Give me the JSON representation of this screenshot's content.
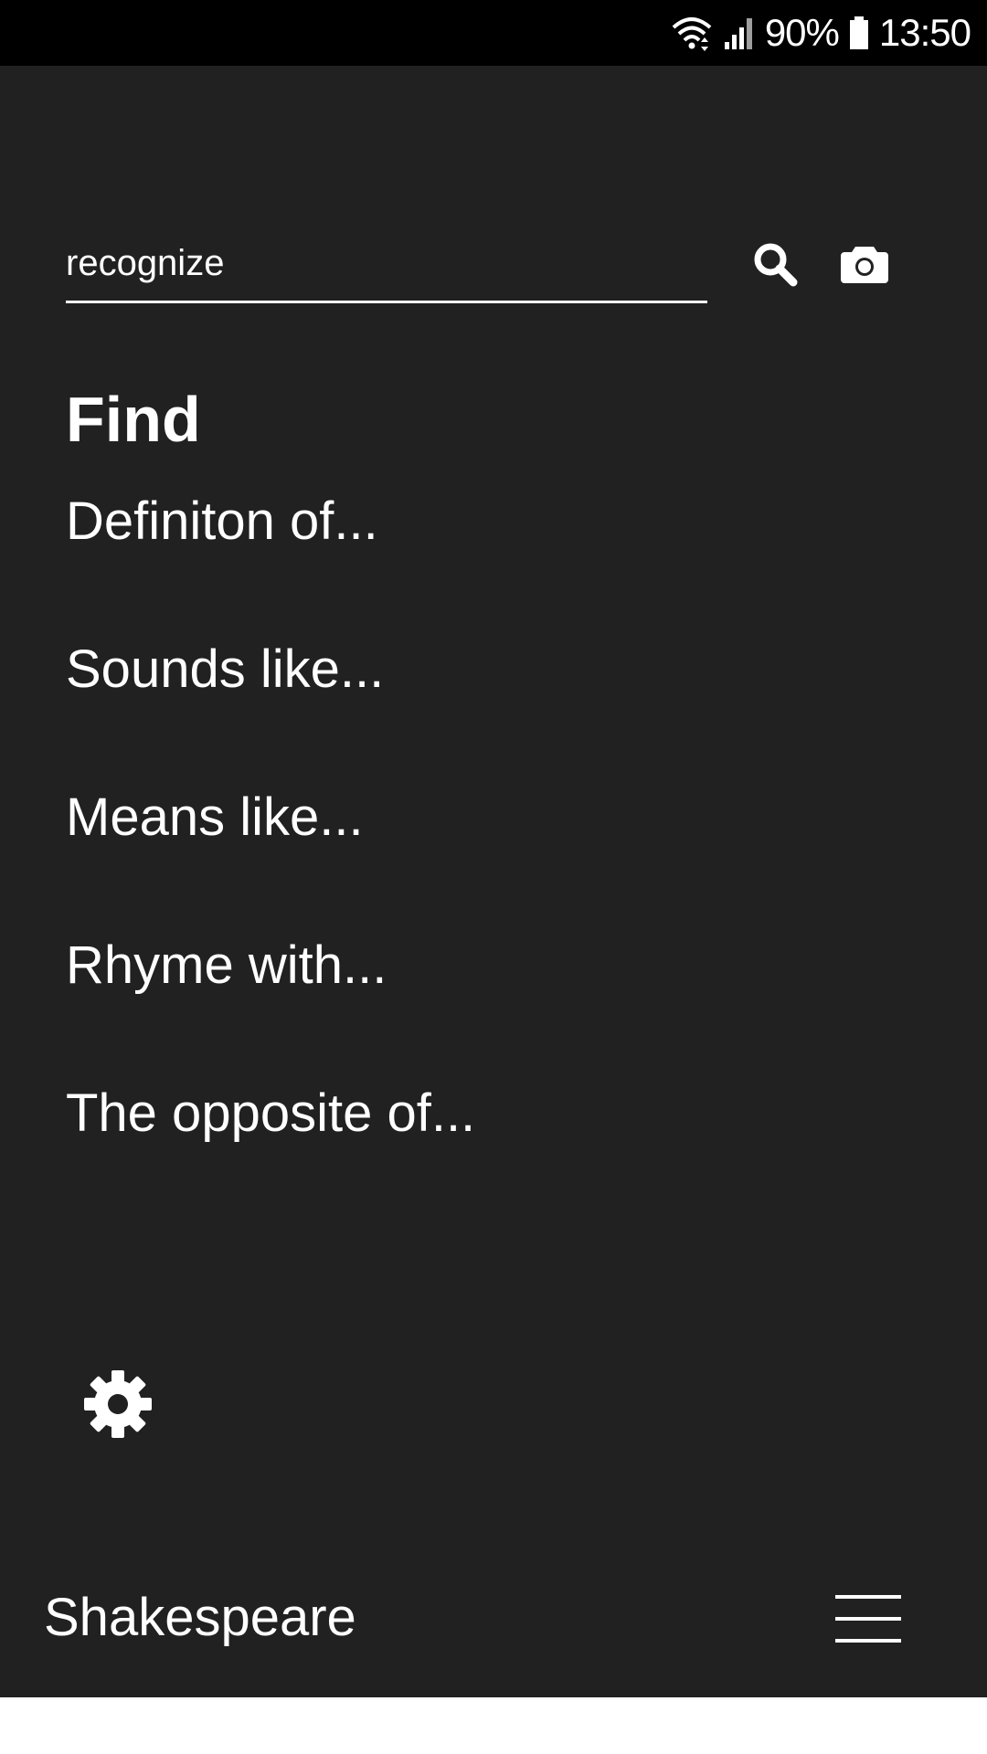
{
  "status_bar": {
    "battery_percent": "90%",
    "time": "13:50",
    "icons": [
      "wifi-icon",
      "signal-icon",
      "battery-icon"
    ]
  },
  "search": {
    "value": "recognize",
    "search_icon": "search-icon",
    "camera_icon": "camera-icon"
  },
  "find": {
    "heading": "Find",
    "items": [
      {
        "label": "Definiton of..."
      },
      {
        "label": "Sounds like..."
      },
      {
        "label": "Means like..."
      },
      {
        "label": "Rhyme with..."
      },
      {
        "label": "The opposite of..."
      }
    ]
  },
  "settings": {
    "icon": "gear-icon"
  },
  "bottom_bar": {
    "app_title": "Shakespeare",
    "menu_icon": "hamburger-menu-icon"
  },
  "colors": {
    "background": "#212121",
    "status_bar": "#000000",
    "text": "#ffffff"
  }
}
